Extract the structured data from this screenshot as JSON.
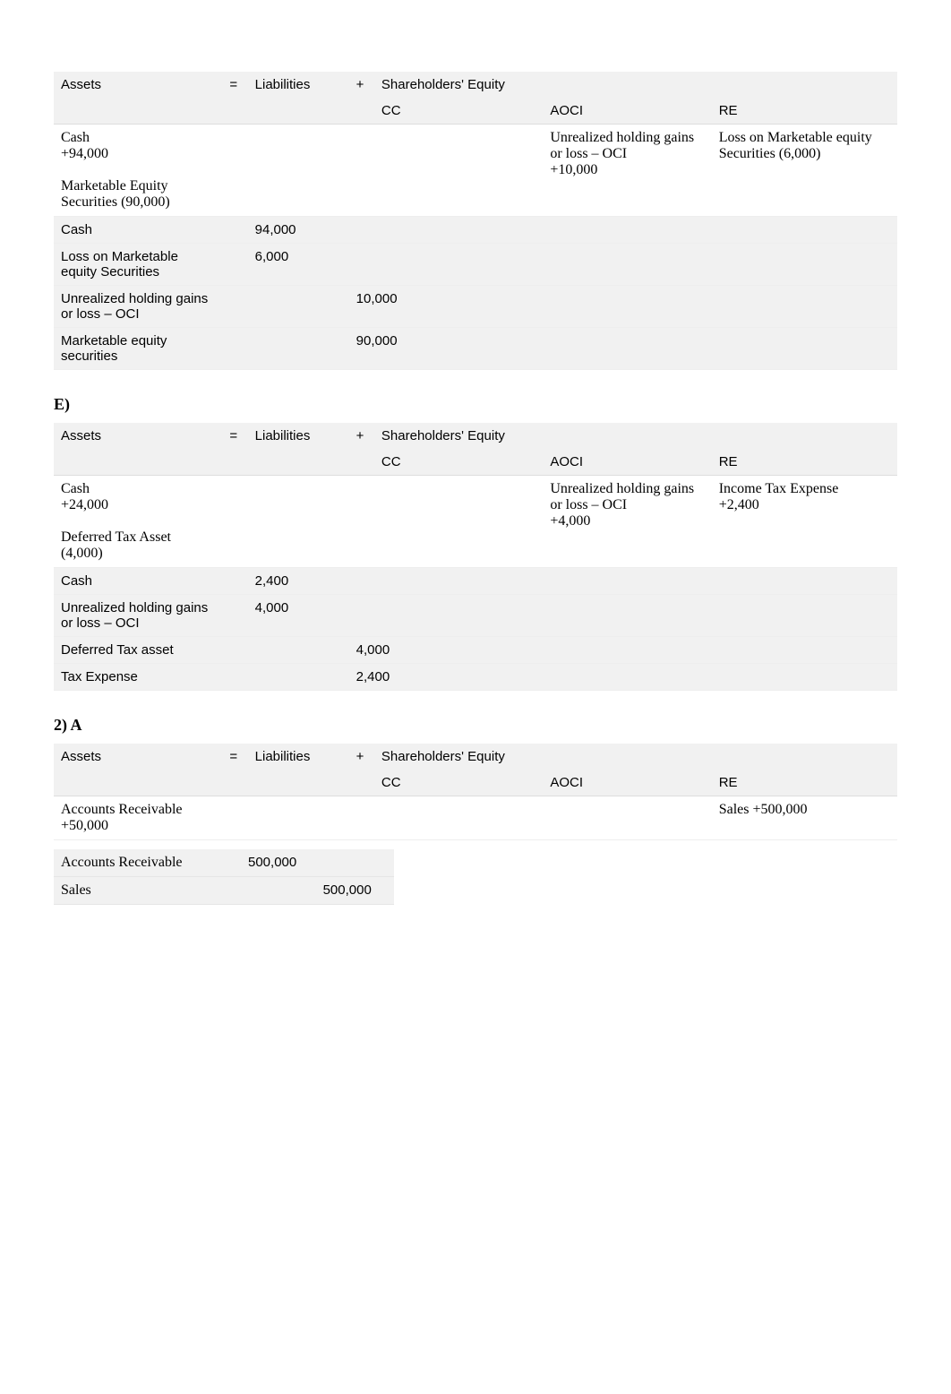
{
  "headers": {
    "assets": "Assets",
    "eq": "=",
    "liabilities": "Liabilities",
    "plus": "+",
    "shareholders": "Shareholders' Equity",
    "cc": "CC",
    "aoci": "AOCI",
    "re": "RE"
  },
  "table1": {
    "row1": {
      "assets": "Cash\n+94,000\n\nMarketable Equity Securities (90,000)",
      "aoci": "Unrealized holding gains or loss – OCI\n+10,000",
      "re": "Loss on Marketable equity Securities (6,000)"
    },
    "journal": [
      {
        "account": "Cash",
        "debit": "94,000",
        "credit": ""
      },
      {
        "account": "Loss on Marketable equity Securities",
        "debit": "6,000",
        "credit": ""
      },
      {
        "account": "Unrealized holding gains or loss – OCI",
        "debit": "",
        "credit": "10,000"
      },
      {
        "account": "Marketable equity securities",
        "debit": "",
        "credit": "90,000"
      }
    ]
  },
  "sectionE": "E)",
  "table2": {
    "row1": {
      "assets": "Cash\n+24,000\n\nDeferred Tax Asset (4,000)",
      "aoci": "Unrealized holding gains or loss – OCI\n+4,000",
      "re": "Income Tax Expense\n+2,400"
    },
    "journal": [
      {
        "account": "Cash",
        "debit": "2,400",
        "credit": ""
      },
      {
        "account": "Unrealized holding gains or loss – OCI",
        "debit": "4,000",
        "credit": ""
      },
      {
        "account": "Deferred Tax asset",
        "debit": "",
        "credit": "4,000"
      },
      {
        "account": "Tax Expense",
        "debit": "",
        "credit": "2,400"
      }
    ]
  },
  "section2A": "2) A",
  "table3": {
    "row1": {
      "assets": "Accounts Receivable\n+50,000",
      "re": "Sales +500,000"
    },
    "journal": [
      {
        "account": "Accounts Receivable",
        "debit": "500,000",
        "credit": ""
      },
      {
        "account": "Sales",
        "debit": "",
        "credit": "500,000"
      }
    ]
  }
}
